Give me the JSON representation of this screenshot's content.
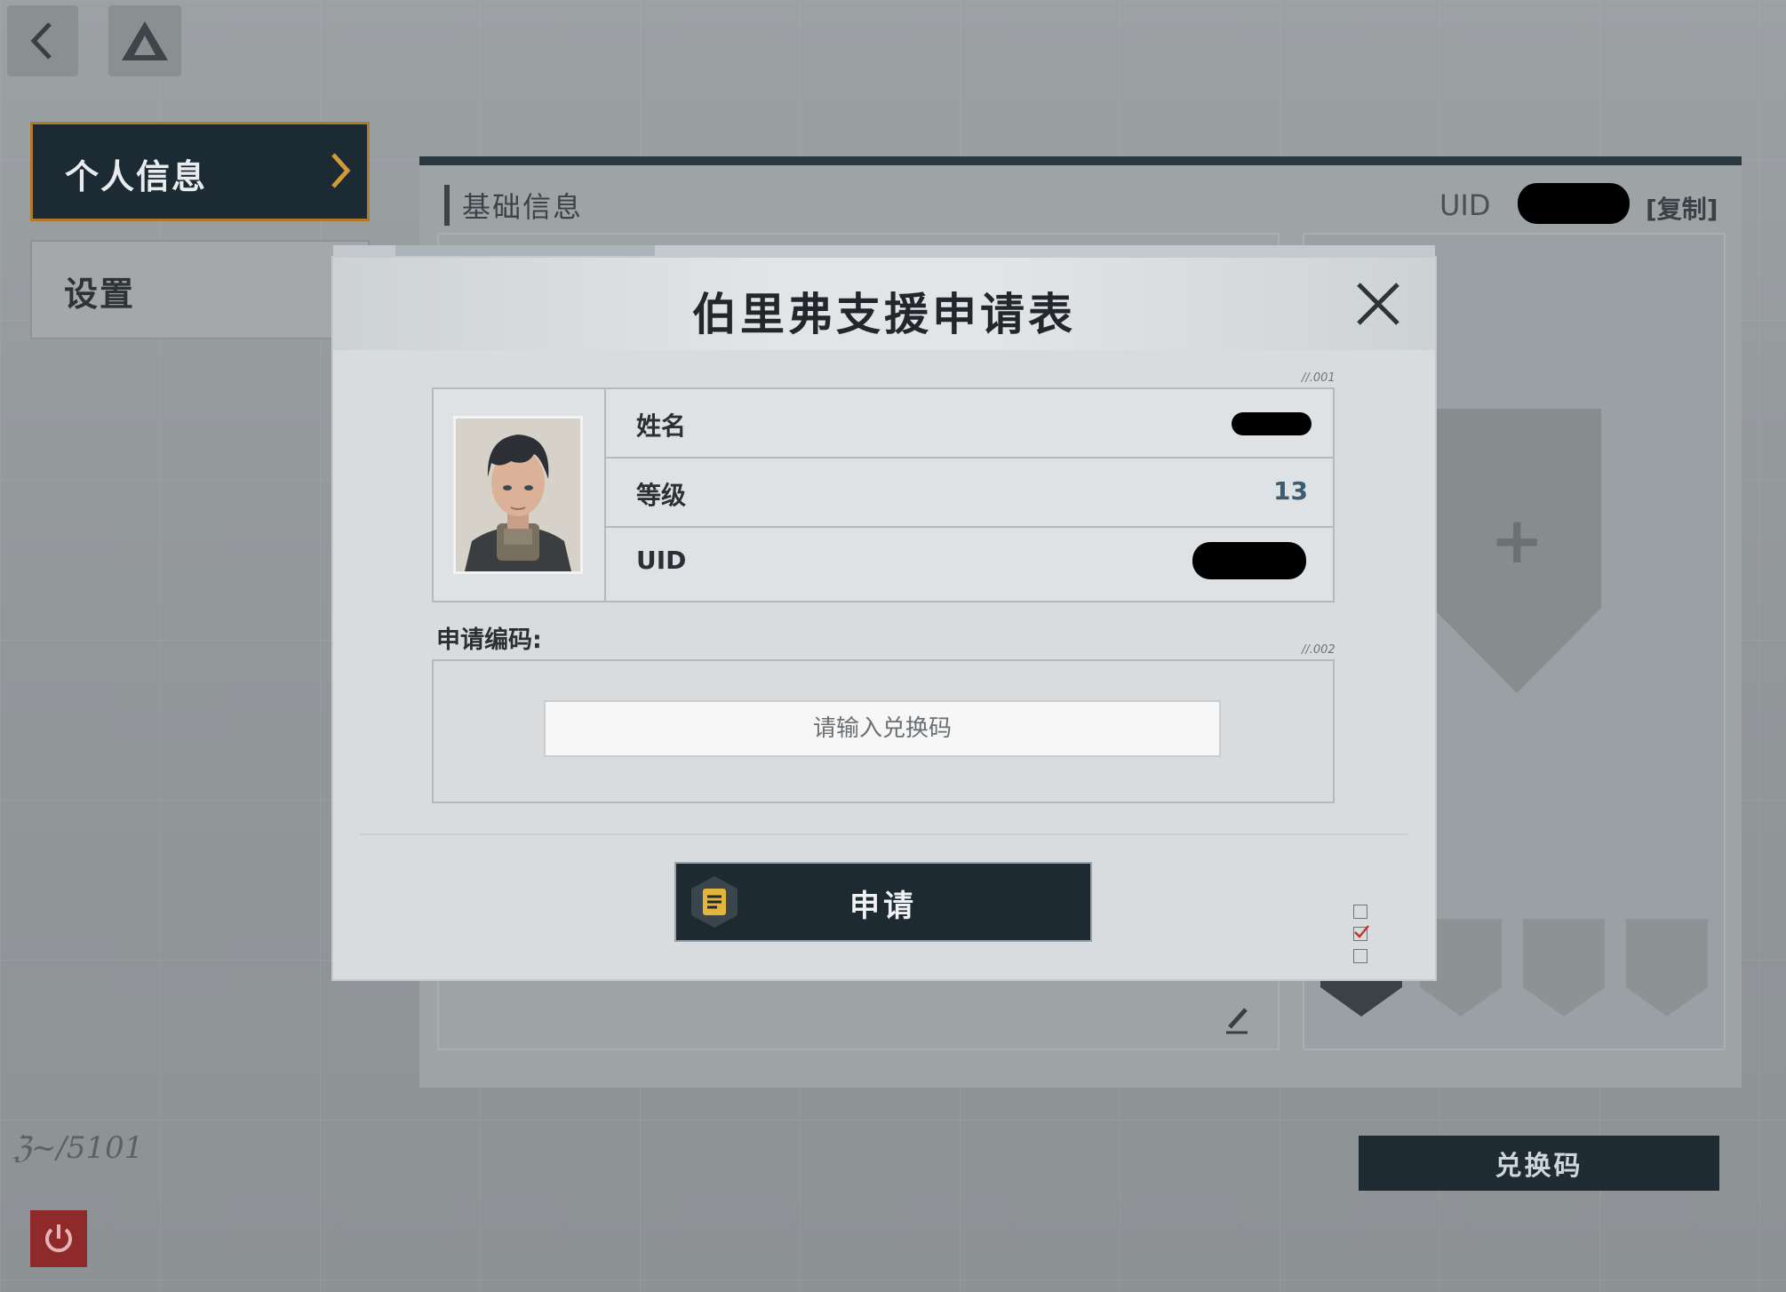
{
  "sidebar": {
    "items": [
      {
        "label": "个人信息",
        "active": true
      },
      {
        "label": "设置",
        "active": false
      }
    ]
  },
  "info_panel": {
    "title": "基础信息",
    "uid_label": "UID",
    "copy_label": "[复制]"
  },
  "redeem_button_label": "兑换码",
  "dialog": {
    "title": "伯里弗支援申请表",
    "tag_profile": "//.001",
    "tag_code": "//.002",
    "fields": [
      {
        "label": "姓名",
        "value": "",
        "redacted": true
      },
      {
        "label": "等级",
        "value": "13",
        "redacted": false
      },
      {
        "label": "UID",
        "value": "",
        "redacted": true
      }
    ],
    "code_label": "申请编码:",
    "code_placeholder": "请输入兑换码",
    "code_value": "",
    "submit_label": "申请"
  },
  "colors": {
    "dark_panel": "#1d2a32",
    "accent_gold": "#e3b53a",
    "level_value": "#3a5c72",
    "dialog_bg": "#d9dcde",
    "power_red": "#8e2a2a"
  },
  "icons": [
    "back-icon",
    "home-logo-icon",
    "chevron-right-icon",
    "close-icon",
    "document-icon",
    "edit-icon",
    "power-icon",
    "plus-icon"
  ]
}
